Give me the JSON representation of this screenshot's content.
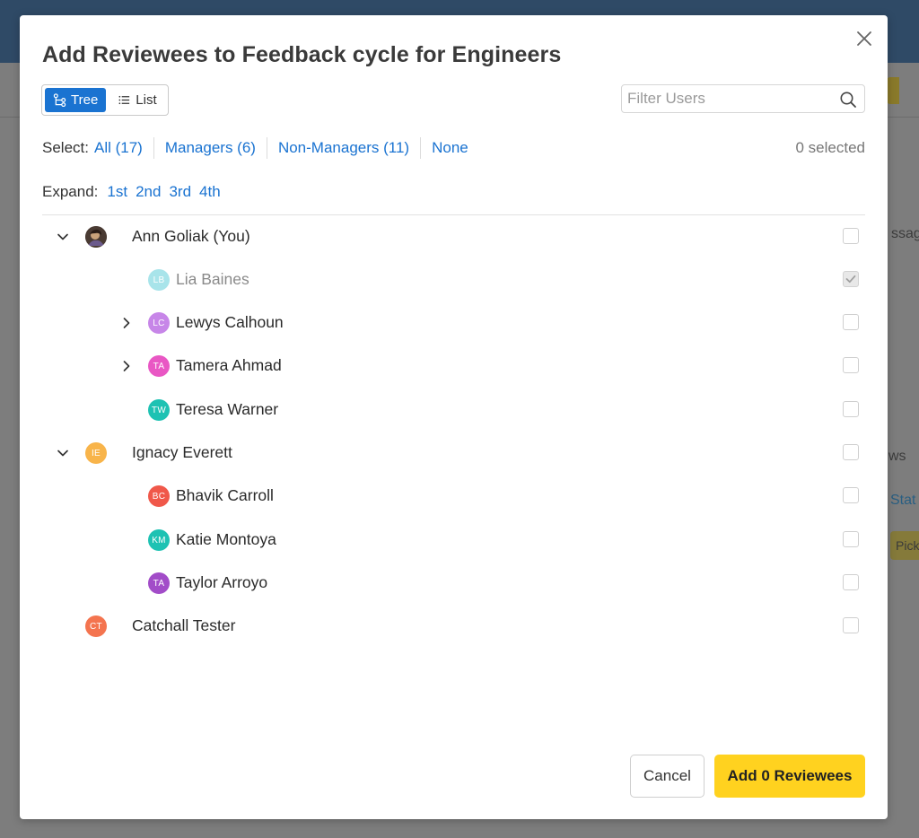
{
  "background": {
    "right_texts": [
      "ssage",
      "ws",
      "Stat",
      "Pick"
    ]
  },
  "modal": {
    "title": "Add Reviewees to Feedback cycle for Engineers",
    "view_toggle": {
      "tree_label": "Tree",
      "list_label": "List"
    },
    "filter": {
      "placeholder": "Filter Users",
      "value": ""
    },
    "select": {
      "label": "Select:",
      "options": [
        "All (17)",
        "Managers (6)",
        "Non-Managers (11)",
        "None"
      ],
      "selected_count": "0 selected"
    },
    "expand": {
      "label": "Expand:",
      "levels": [
        "1st",
        "2nd",
        "3rd",
        "4th"
      ]
    },
    "users": [
      {
        "name": "Ann Goliak (You)",
        "initials": "",
        "avatar_color": "#3b2f2a",
        "caret": "down",
        "checked": false,
        "disabled": false
      },
      {
        "name": "Lia Baines",
        "initials": "LB",
        "avatar_color": "#a8e4ea",
        "caret": "none",
        "checked": true,
        "disabled": true
      },
      {
        "name": "Lewys Calhoun",
        "initials": "LC",
        "avatar_color": "#c786e8",
        "caret": "right",
        "checked": false,
        "disabled": false
      },
      {
        "name": "Tamera Ahmad",
        "initials": "TA",
        "avatar_color": "#e957c4",
        "caret": "right",
        "checked": false,
        "disabled": false
      },
      {
        "name": "Teresa Warner",
        "initials": "TW",
        "avatar_color": "#1ec2b3",
        "caret": "none",
        "checked": false,
        "disabled": false
      },
      {
        "name": "Ignacy Everett",
        "initials": "IE",
        "avatar_color": "#f8b44a",
        "caret": "down",
        "checked": false,
        "disabled": false
      },
      {
        "name": "Bhavik Carroll",
        "initials": "BC",
        "avatar_color": "#f0584a",
        "caret": "none",
        "checked": false,
        "disabled": false
      },
      {
        "name": "Katie Montoya",
        "initials": "KM",
        "avatar_color": "#1ec2b3",
        "caret": "none",
        "checked": false,
        "disabled": false
      },
      {
        "name": "Taylor Arroyo",
        "initials": "TA",
        "avatar_color": "#a24cc8",
        "caret": "none",
        "checked": false,
        "disabled": false
      },
      {
        "name": "Catchall Tester",
        "initials": "CT",
        "avatar_color": "#f4744f",
        "caret": "none",
        "checked": false,
        "disabled": false
      }
    ],
    "footer": {
      "cancel_label": "Cancel",
      "add_label": "Add 0 Reviewees"
    }
  }
}
